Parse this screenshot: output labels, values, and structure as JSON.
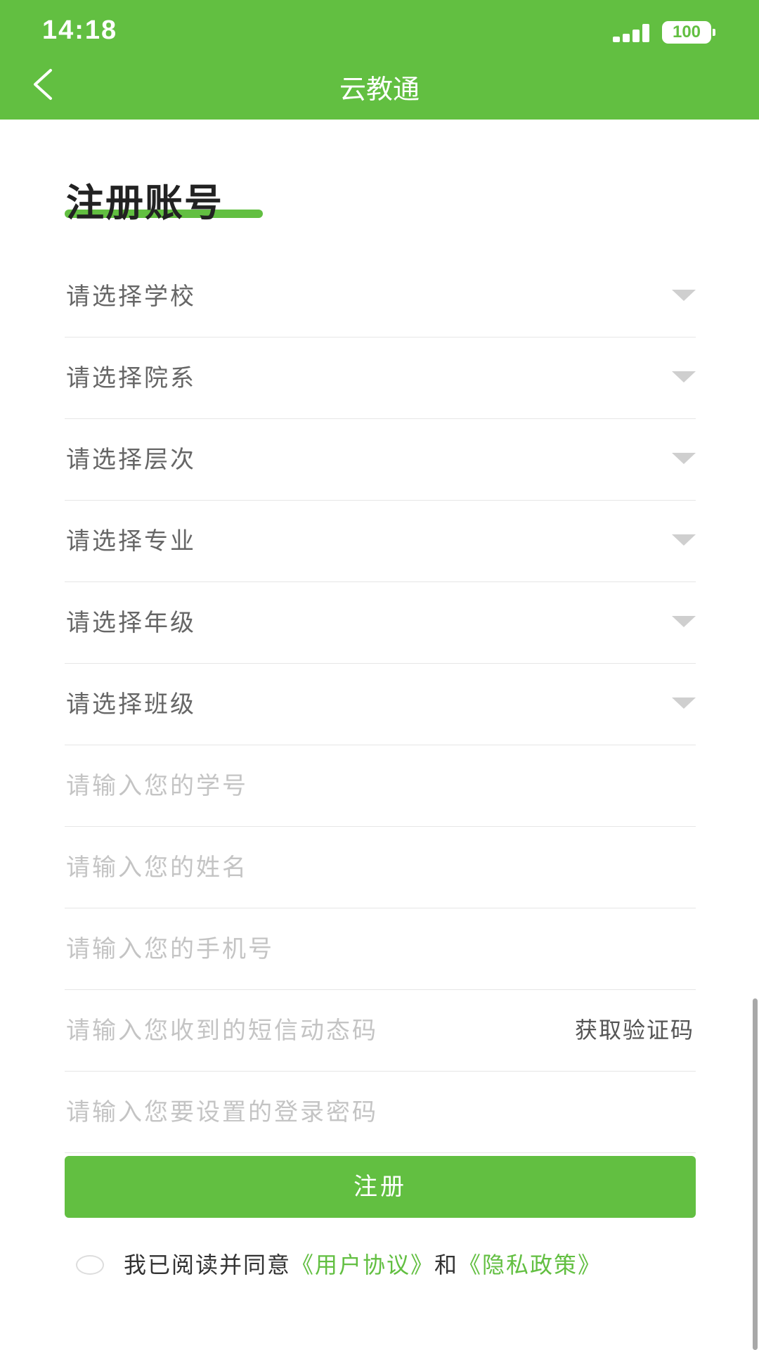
{
  "status_bar": {
    "time": "14:18",
    "battery": "100"
  },
  "nav": {
    "title": "云教通",
    "back_icon": "chevron-left-icon"
  },
  "page": {
    "title": "注册账号"
  },
  "form": {
    "selects": [
      {
        "placeholder": "请选择学校"
      },
      {
        "placeholder": "请选择院系"
      },
      {
        "placeholder": "请选择层次"
      },
      {
        "placeholder": "请选择专业"
      },
      {
        "placeholder": "请选择年级"
      },
      {
        "placeholder": "请选择班级"
      }
    ],
    "inputs": [
      {
        "placeholder": "请输入您的学号"
      },
      {
        "placeholder": "请输入您的姓名"
      },
      {
        "placeholder": "请输入您的手机号"
      },
      {
        "placeholder": "请输入您收到的短信动态码"
      },
      {
        "placeholder": "请输入您要设置的登录密码"
      }
    ],
    "sms_button": "获取验证码",
    "submit": "注册"
  },
  "agreement": {
    "prefix": "我已阅读并同意",
    "user_agreement": "《用户协议》",
    "and": "和",
    "privacy_policy": "《隐私政策》"
  },
  "colors": {
    "brand_green": "#62bf41",
    "select_text": "#666666",
    "placeholder_text": "#c4c4c4"
  }
}
